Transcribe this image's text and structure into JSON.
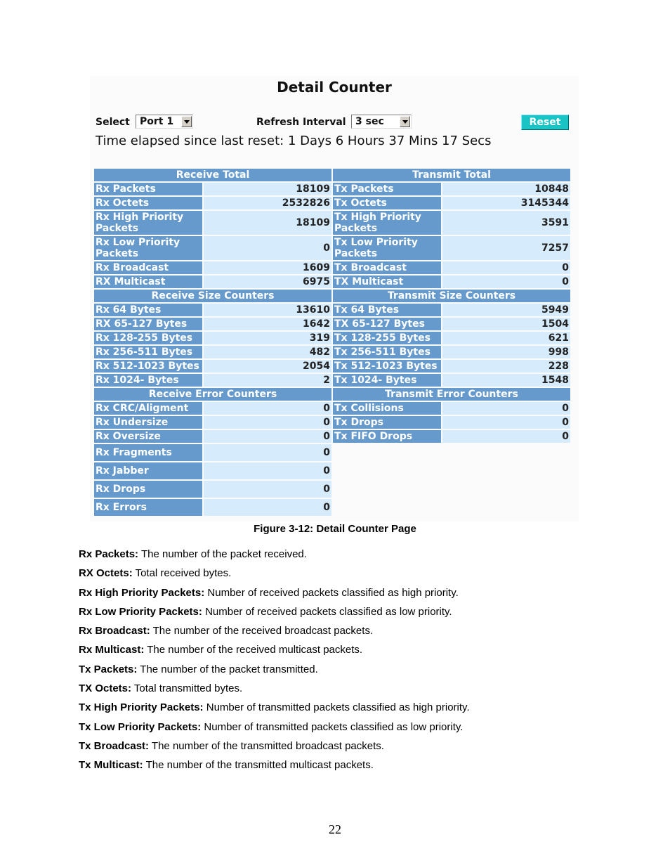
{
  "page": {
    "title": "Detail Counter",
    "controls": {
      "select_label": "Select",
      "port_value": "Port 1",
      "refresh_label": "Refresh Interval",
      "refresh_value": "3 sec",
      "reset_label": "Reset"
    },
    "elapsed": "Time elapsed since last reset: 1 Days 6 Hours 37 Mins 17 Secs"
  },
  "table": {
    "sections": [
      {
        "rx_header": "Receive Total",
        "tx_header": "Transmit Total",
        "rows": [
          {
            "rx_label": "Rx Packets",
            "rx_value": "18109",
            "tx_label": "Tx Packets",
            "tx_value": "10848"
          },
          {
            "rx_label": "Rx Octets",
            "rx_value": "2532826",
            "tx_label": "Tx Octets",
            "tx_value": "3145344"
          },
          {
            "rx_label": "Rx High Priority Packets",
            "rx_value": "18109",
            "tx_label": "Tx High Priority Packets",
            "tx_value": "3591"
          },
          {
            "rx_label": "Rx Low Priority Packets",
            "rx_value": "0",
            "tx_label": "Tx Low Priority Packets",
            "tx_value": "7257"
          },
          {
            "rx_label": "Rx Broadcast",
            "rx_value": "1609",
            "tx_label": "Tx Broadcast",
            "tx_value": "0"
          },
          {
            "rx_label": "RX Multicast",
            "rx_value": "6975",
            "tx_label": "TX Multicast",
            "tx_value": "0"
          }
        ]
      },
      {
        "rx_header": "Receive Size Counters",
        "tx_header": "Transmit Size Counters",
        "rows": [
          {
            "rx_label": "Rx 64 Bytes",
            "rx_value": "13610",
            "tx_label": "Tx 64 Bytes",
            "tx_value": "5949"
          },
          {
            "rx_label": "RX 65-127 Bytes",
            "rx_value": "1642",
            "tx_label": "TX 65-127 Bytes",
            "tx_value": "1504"
          },
          {
            "rx_label": "Rx 128-255 Bytes",
            "rx_value": "319",
            "tx_label": "Tx 128-255 Bytes",
            "tx_value": "621"
          },
          {
            "rx_label": "Rx 256-511 Bytes",
            "rx_value": "482",
            "tx_label": "Tx 256-511 Bytes",
            "tx_value": "998"
          },
          {
            "rx_label": "Rx 512-1023 Bytes",
            "rx_value": "2054",
            "tx_label": "Tx 512-1023 Bytes",
            "tx_value": "228"
          },
          {
            "rx_label": "Rx 1024- Bytes",
            "rx_value": "2",
            "tx_label": "Tx 1024- Bytes",
            "tx_value": "1548"
          }
        ]
      },
      {
        "rx_header": "Receive Error Counters",
        "tx_header": "Transmit Error Counters",
        "rows": [
          {
            "rx_label": "Rx CRC/Aligment",
            "rx_value": "0",
            "tx_label": "Tx Collisions",
            "tx_value": "0"
          },
          {
            "rx_label": "Rx Undersize",
            "rx_value": "0",
            "tx_label": "Tx Drops",
            "tx_value": "0"
          },
          {
            "rx_label": "Rx Oversize",
            "rx_value": "0",
            "tx_label": "Tx FIFO Drops",
            "tx_value": "0"
          },
          {
            "rx_label": "Rx Fragments",
            "rx_value": "0"
          },
          {
            "rx_label": "Rx Jabber",
            "rx_value": "0"
          },
          {
            "rx_label": "Rx Drops",
            "rx_value": "0"
          },
          {
            "rx_label": "Rx Errors",
            "rx_value": "0"
          }
        ]
      }
    ]
  },
  "caption": "Figure 3-12: Detail Counter Page",
  "descriptions": [
    {
      "term": "Rx Packets:",
      "text": " The number of the packet received."
    },
    {
      "term": "RX Octets:",
      "text": " Total received bytes."
    },
    {
      "term": "Rx High Priority Packets:",
      "text": " Number of received packets classified as high priority."
    },
    {
      "term": "Rx Low Priority Packets:",
      "text": " Number of received packets classified as low priority."
    },
    {
      "term": "Rx Broadcast:",
      "text": " The number of the received broadcast packets."
    },
    {
      "term": "Rx Multicast:",
      "text": " The number of the received multicast packets."
    },
    {
      "term": "Tx Packets:",
      "text": " The number of the packet transmitted."
    },
    {
      "term": "TX Octets:",
      "text": " Total transmitted bytes."
    },
    {
      "term": "Tx High Priority Packets:",
      "text": " Number of transmitted packets classified as high priority."
    },
    {
      "term": "Tx Low Priority Packets:",
      "text": " Number of transmitted packets classified as low priority."
    },
    {
      "term": "Tx Broadcast:",
      "text": " The number of the transmitted broadcast packets."
    },
    {
      "term": "Tx Multicast:",
      "text": " The number of the transmitted multicast packets."
    }
  ],
  "page_number": "22"
}
